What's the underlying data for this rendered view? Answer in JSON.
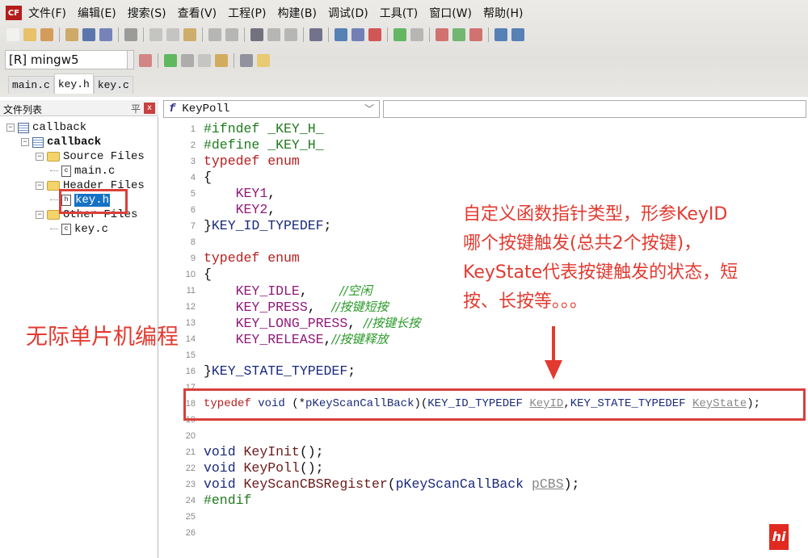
{
  "app": {
    "logo_text": "CF"
  },
  "menu": [
    "文件(F)",
    "编辑(E)",
    "搜索(S)",
    "查看(V)",
    "工程(P)",
    "构建(B)",
    "调试(D)",
    "工具(T)",
    "窗口(W)",
    "帮助(H)"
  ],
  "compiler": {
    "selected": "[R] mingw5"
  },
  "tabs": [
    {
      "label": "main.c"
    },
    {
      "label": "key.h",
      "active": true
    },
    {
      "label": "key.c"
    }
  ],
  "panel": {
    "title": "文件列表",
    "pin": "平",
    "close": "x"
  },
  "tree": [
    {
      "label": "callback",
      "level": 0,
      "type": "workspace"
    },
    {
      "label": "callback",
      "level": 1,
      "type": "project",
      "bold": true
    },
    {
      "label": "Source Files",
      "level": 2,
      "type": "folder"
    },
    {
      "label": "main.c",
      "level": 3,
      "type": "file",
      "glyph": "c"
    },
    {
      "label": "Header Files",
      "level": 2,
      "type": "folder"
    },
    {
      "label": "key.h",
      "level": 3,
      "type": "file",
      "glyph": "h",
      "selected": true
    },
    {
      "label": "Other Files",
      "level": 2,
      "type": "folder"
    },
    {
      "label": "key.c",
      "level": 3,
      "type": "file",
      "glyph": "c"
    }
  ],
  "function_combo": {
    "icon": "f",
    "value": "KeyPoll"
  },
  "code": [
    [
      [
        "pp",
        "#ifndef _KEY_H_"
      ]
    ],
    [
      [
        "pp",
        "#define _KEY_H_"
      ]
    ],
    [
      [
        "kw",
        "typedef enum"
      ]
    ],
    [
      [
        "pl",
        "{"
      ]
    ],
    [
      [
        "pl",
        "    "
      ],
      [
        "en",
        "KEY1"
      ],
      [
        "pl",
        ","
      ]
    ],
    [
      [
        "pl",
        "    "
      ],
      [
        "en",
        "KEY2"
      ],
      [
        "pl",
        ","
      ]
    ],
    [
      [
        "pl",
        "}"
      ],
      [
        "ty",
        "KEY_ID_TYPEDEF"
      ],
      [
        "pl",
        ";"
      ]
    ],
    [],
    [
      [
        "kw",
        "typedef enum"
      ]
    ],
    [
      [
        "pl",
        "{"
      ]
    ],
    [
      [
        "pl",
        "    "
      ],
      [
        "en",
        "KEY_IDLE"
      ],
      [
        "pl",
        ",    "
      ],
      [
        "cm",
        "//空闲"
      ]
    ],
    [
      [
        "pl",
        "    "
      ],
      [
        "en",
        "KEY_PRESS"
      ],
      [
        "pl",
        ",  "
      ],
      [
        "cm",
        "//按键短按"
      ]
    ],
    [
      [
        "pl",
        "    "
      ],
      [
        "en",
        "KEY_LONG_PRESS"
      ],
      [
        "pl",
        ", "
      ],
      [
        "cm",
        "//按键长按"
      ]
    ],
    [
      [
        "pl",
        "    "
      ],
      [
        "en",
        "KEY_RELEASE"
      ],
      [
        "pl",
        ","
      ],
      [
        "cm",
        "//按键释放"
      ]
    ],
    [],
    [
      [
        "pl",
        "}"
      ],
      [
        "ty",
        "KEY_STATE_TYPEDEF"
      ],
      [
        "pl",
        ";"
      ]
    ],
    [],
    [
      [
        "kw",
        "typedef"
      ],
      [
        "pl",
        " "
      ],
      [
        "ty",
        "void"
      ],
      [
        "pl",
        " (*"
      ],
      [
        "ty",
        "pKeyScanCallBack"
      ],
      [
        "pl",
        ")("
      ],
      [
        "ty",
        "KEY_ID_TYPEDEF"
      ],
      [
        "pl",
        " "
      ],
      [
        "pa",
        "KeyID"
      ],
      [
        "pl",
        ","
      ],
      [
        "ty",
        "KEY_STATE_TYPEDEF"
      ],
      [
        "pl",
        " "
      ],
      [
        "pa",
        "KeyState"
      ],
      [
        "pl",
        ");"
      ]
    ],
    [],
    [],
    [
      [
        "ty",
        "void"
      ],
      [
        "pl",
        " "
      ],
      [
        "fn",
        "KeyInit"
      ],
      [
        "pl",
        "();"
      ]
    ],
    [
      [
        "ty",
        "void"
      ],
      [
        "pl",
        " "
      ],
      [
        "fn",
        "KeyPoll"
      ],
      [
        "pl",
        "();"
      ]
    ],
    [
      [
        "ty",
        "void"
      ],
      [
        "pl",
        " "
      ],
      [
        "fn",
        "KeyScanCBSRegister"
      ],
      [
        "pl",
        "("
      ],
      [
        "ty",
        "pKeyScanCallBack"
      ],
      [
        "pl",
        " "
      ],
      [
        "pa",
        "pCBS"
      ],
      [
        "pl",
        ");"
      ]
    ],
    [
      [
        "pp",
        "#endif"
      ]
    ],
    [],
    []
  ],
  "annotations": {
    "left": "无际单片机编程",
    "right": [
      "自定义函数指针类型，形参KeyID",
      "哪个按键触发(总共2个按键)，",
      "KeyState代表按键触发的状态，短",
      "按、长按等。。。"
    ]
  },
  "colors": {
    "annotation": "#e23a30",
    "selection": "#1672c4"
  },
  "watermark": {
    "text": "hi"
  }
}
